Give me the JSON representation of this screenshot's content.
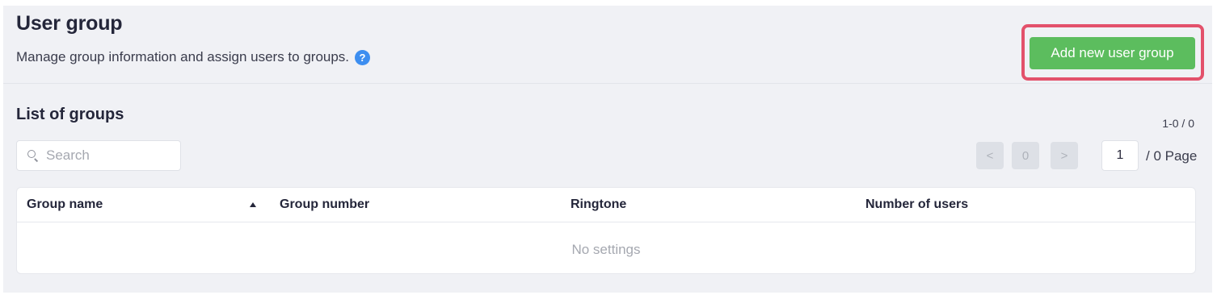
{
  "header": {
    "title": "User group",
    "description": "Manage group information and assign users to groups.",
    "help_icon_glyph": "?",
    "add_button_label": "Add new user group"
  },
  "groups": {
    "section_title": "List of groups",
    "range_text": "1-0 / 0",
    "search_placeholder": "Search",
    "pager": {
      "prev_glyph": "<",
      "current_page_indicator": "0",
      "next_glyph": ">",
      "page_input_value": "1",
      "total_pages_text": "/ 0 Page"
    },
    "columns": [
      "Group name",
      "Group number",
      "Ringtone",
      "Number of users"
    ],
    "sort": "ascending",
    "empty_text": "No settings"
  },
  "colors": {
    "accent_green": "#5cbd5e",
    "highlight_red": "#e3516b",
    "help_blue": "#3d8ef0"
  }
}
